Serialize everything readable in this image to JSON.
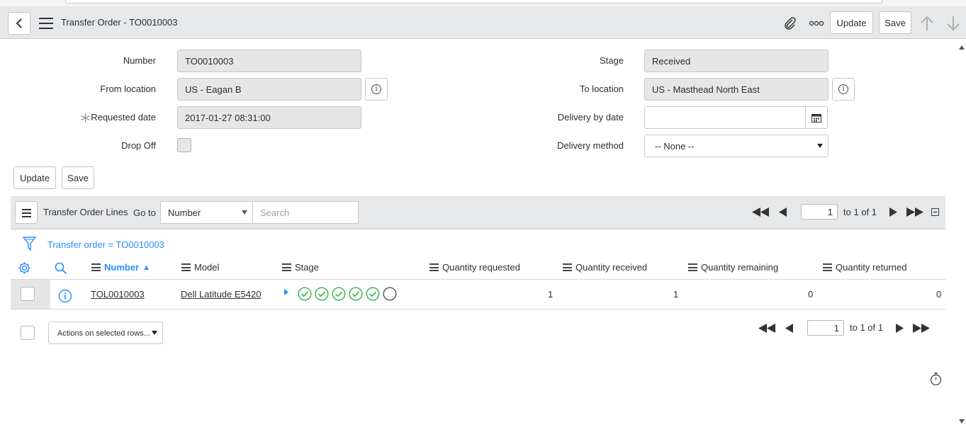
{
  "header": {
    "title": "Transfer Order - TO0010003",
    "update_label": "Update",
    "save_label": "Save"
  },
  "form": {
    "number_label": "Number",
    "number_value": "TO0010003",
    "from_location_label": "From location",
    "from_location_value": "US - Eagan B",
    "requested_date_label": "Requested date",
    "requested_date_value": "2017-01-27 08:31:00",
    "drop_off_label": "Drop Off",
    "stage_label": "Stage",
    "stage_value": "Received",
    "to_location_label": "To location",
    "to_location_value": "US - Masthead North East",
    "delivery_by_date_label": "Delivery by date",
    "delivery_by_date_value": "",
    "delivery_method_label": "Delivery method",
    "delivery_method_value": "-- None --",
    "update_label": "Update",
    "save_label": "Save"
  },
  "related_list": {
    "title": "Transfer Order Lines",
    "goto_label": "Go to",
    "goto_field": "Number",
    "search_placeholder": "Search",
    "page_value": "1",
    "page_range": "to 1 of 1",
    "filter_text": "Transfer order = TO0010003",
    "columns": [
      "Number",
      "Model",
      "Stage",
      "Quantity requested",
      "Quantity received",
      "Quantity remaining",
      "Quantity returned"
    ],
    "sort_indicator": "▲",
    "rows": [
      {
        "number": "TOL0010003",
        "model": "Dell Latitude E5420",
        "stages_complete": 5,
        "stages_total": 6,
        "quantity_requested": "1",
        "quantity_received": "1",
        "quantity_remaining": "0",
        "quantity_returned": "0"
      }
    ],
    "actions_label": "Actions on selected rows...",
    "bottom_page_value": "1",
    "bottom_page_range": "to 1 of 1"
  },
  "colors": {
    "accent": "#278efc",
    "stage_complete": "#2fb34a",
    "header_bg": "#e6e8ea"
  },
  "icons": [
    "back-icon",
    "menu-icon",
    "paperclip-icon",
    "more-icon",
    "arrow-up-icon",
    "arrow-down-icon",
    "info-icon",
    "calendar-icon",
    "required-icon",
    "filter-icon",
    "gear-icon",
    "search-icon",
    "first-page-icon",
    "prev-page-icon",
    "next-page-icon",
    "last-page-icon",
    "collapse-icon",
    "timer-icon"
  ]
}
